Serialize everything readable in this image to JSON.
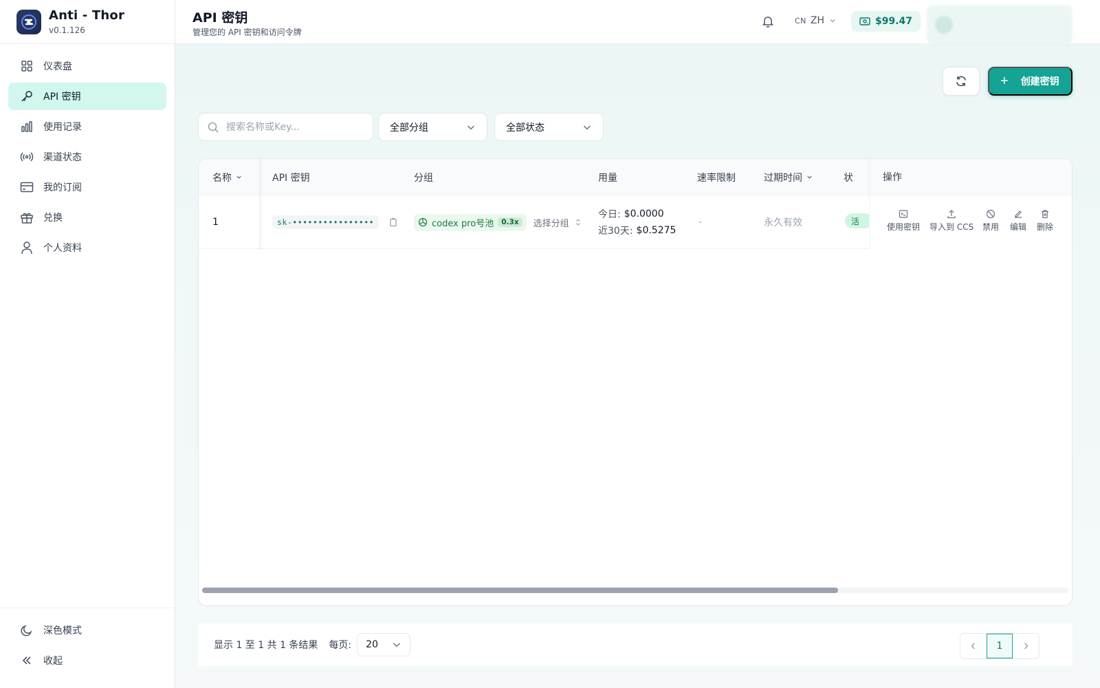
{
  "app": {
    "name": "Anti - Thor",
    "version": "v0.1.126"
  },
  "sidebar": {
    "items": [
      {
        "label": "仪表盘",
        "icon": "dashboard-icon"
      },
      {
        "label": "API 密钥",
        "icon": "key-icon",
        "active": true
      },
      {
        "label": "使用记录",
        "icon": "bar-chart-icon"
      },
      {
        "label": "渠道状态",
        "icon": "signal-icon"
      },
      {
        "label": "我的订阅",
        "icon": "credit-card-icon"
      },
      {
        "label": "兑换",
        "icon": "gift-icon"
      },
      {
        "label": "个人资料",
        "icon": "user-icon"
      }
    ],
    "dark_mode": "深色模式",
    "collapse": "收起"
  },
  "header": {
    "title": "API 密钥",
    "subtitle": "管理您的 API 密钥和访问令牌",
    "lang_code": "CN",
    "lang": "ZH",
    "balance": "$99.47"
  },
  "toolbar": {
    "create_label": "创建密钥"
  },
  "filters": {
    "search_placeholder": "搜索名称或Key...",
    "group_select": "全部分组",
    "status_select": "全部状态"
  },
  "table": {
    "columns": [
      "名称",
      "API 密钥",
      "分组",
      "用量",
      "速率限制",
      "过期时间",
      "状",
      "操作"
    ],
    "rows": [
      {
        "name": "1",
        "key": "sk-••••••••••••••••",
        "group": "codex pro号池",
        "rate": "0.3x",
        "select_group": "选择分组",
        "usage_today_label": "今日:",
        "usage_today": "$0.0000",
        "usage_30d_label": "近30天:",
        "usage_30d": "$0.5275",
        "rate_limit": "-",
        "expires": "永久有效",
        "status_partial": "活",
        "actions": [
          "使用密钥",
          "导入到 CCS",
          "禁用",
          "编辑",
          "删除"
        ]
      }
    ]
  },
  "footer": {
    "summary": "显示 1 至 1 共 1 条结果",
    "per_page_label": "每页:",
    "per_page": "20",
    "current_page": "1"
  },
  "colors": {
    "accent": "#14a394",
    "active_nav": "#d1f7ef",
    "balance_text": "#0f766e"
  }
}
